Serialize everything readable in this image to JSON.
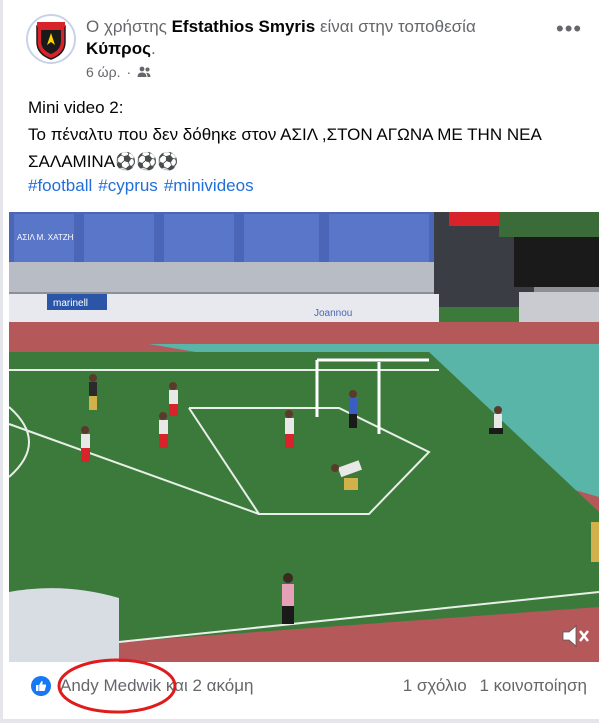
{
  "post": {
    "header": {
      "prefix": "Ο χρήστης",
      "author": "Efstathios Smyris",
      "middle": "είναι στην τοποθεσία",
      "location": "Κύπρος",
      "suffix": "."
    },
    "time": "6 ώρ.",
    "audience_icon": "friends-icon",
    "more_label": "•••",
    "text_lines": [
      "Mini video 2:",
      "Το πέναλτυ που δεν δόθηκε στον ΑΣΙΛ ,ΣΤΟΝ ΑΓΩΝΑ ΜΕ ΤΗΝ ΝΕΑ",
      "ΣΑΛΑΜΙΝΑ⚽⚽⚽"
    ],
    "hashtags": [
      "#football",
      "#cyprus",
      "#minivideos"
    ]
  },
  "video": {
    "watermark": "ΑΣΙΛ Μ. ΧΑΤΖΗ",
    "board_left": "marinell",
    "board_right": "Joannou",
    "mute_icon": "speaker-muted-icon"
  },
  "footer": {
    "reactors": "Andy Medwik",
    "reactors_more": "και 2 ακόμη",
    "comments": "1 σχόλιο",
    "shares": "1 κοινοποίηση"
  },
  "colors": {
    "link": "#216fdb",
    "annotation": "#e01b1b",
    "pitch": "#3b7a3b",
    "track": "#b4585a"
  }
}
